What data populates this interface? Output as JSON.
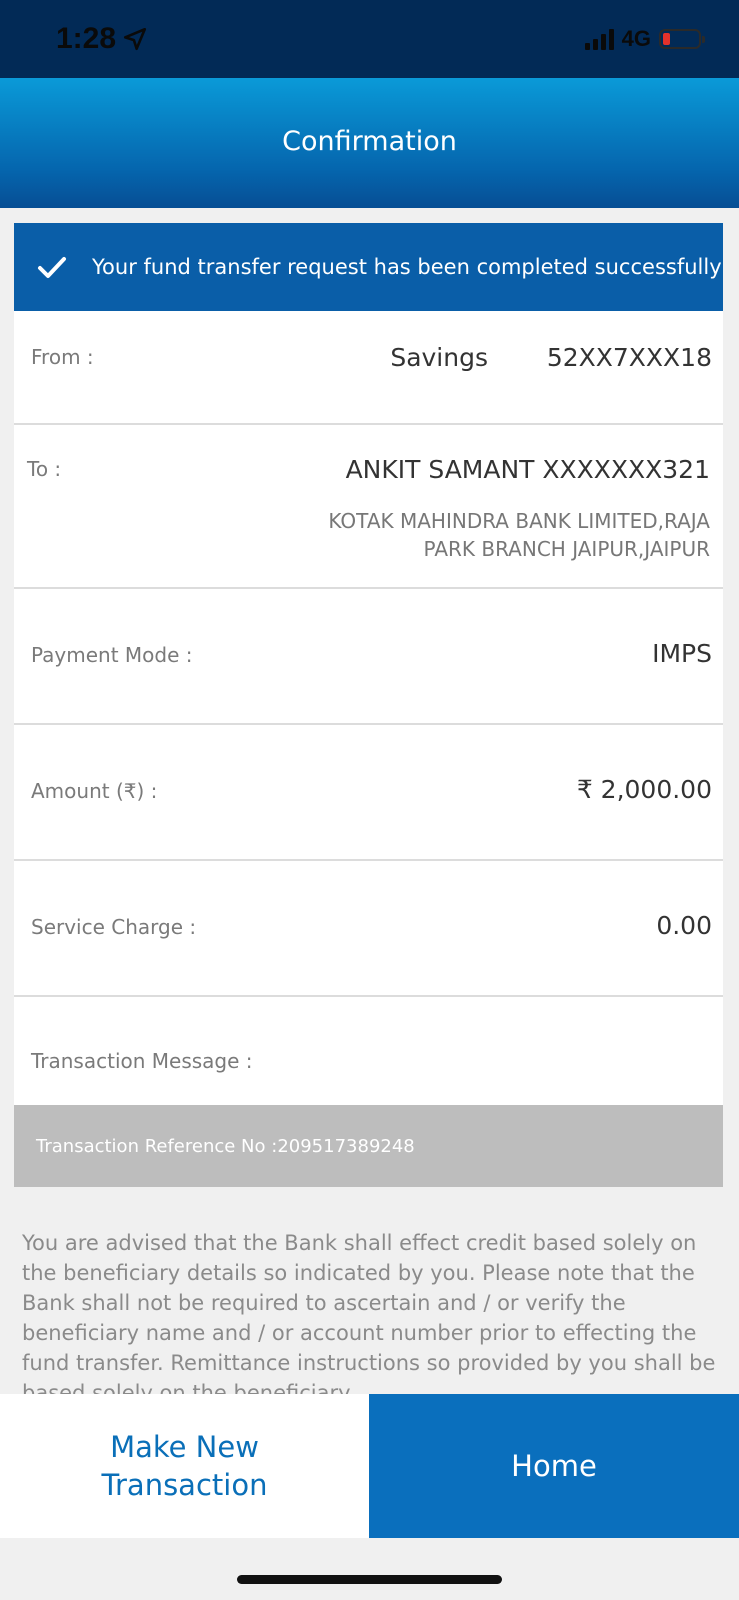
{
  "status_bar": {
    "time": "1:28",
    "network": "4G",
    "icons": [
      "location-arrow-icon",
      "signal-icon",
      "battery-icon"
    ]
  },
  "header": {
    "title": "Confirmation"
  },
  "banner": {
    "icon": "check-icon",
    "message": "Your fund transfer request has been completed successfully"
  },
  "details": {
    "from": {
      "label": "From :",
      "account_type": "Savings",
      "account_number": "52XX7XXX18"
    },
    "to": {
      "label": "To :",
      "name_account": "ANKIT SAMANT XXXXXXX321",
      "bank_line1": "KOTAK MAHINDRA BANK LIMITED,RAJA",
      "bank_line2": "PARK BRANCH JAIPUR,JAIPUR"
    },
    "payment_mode": {
      "label": "Payment Mode :",
      "value": "IMPS"
    },
    "amount": {
      "label": "Amount (₹) :",
      "value": "₹ 2,000.00"
    },
    "service_charge": {
      "label": "Service Charge :",
      "value": "0.00"
    },
    "transaction_message": {
      "label": "Transaction Message :",
      "value": ""
    },
    "reference": "Transaction Reference No :209517389248"
  },
  "disclaimer": "You are advised that the Bank shall effect credit based solely on the beneficiary details so indicated by you. Please note that the Bank shall not be required to ascertain and / or verify the beneficiary name and / or account number prior to effecting the fund transfer. Remittance instructions so provided by you shall be based solely on the beneficiary",
  "buttons": {
    "new_transaction_line1": "Make New",
    "new_transaction_line2": "Transaction",
    "home": "Home"
  },
  "colors": {
    "status_bar": "#022a56",
    "header_top": "#0a9ad8",
    "header_bottom": "#064e94",
    "banner": "#0a5ea8",
    "primary_button": "#0a6fbd",
    "link_text": "#0a6fb8",
    "reference_bar": "#bdbdbd"
  }
}
